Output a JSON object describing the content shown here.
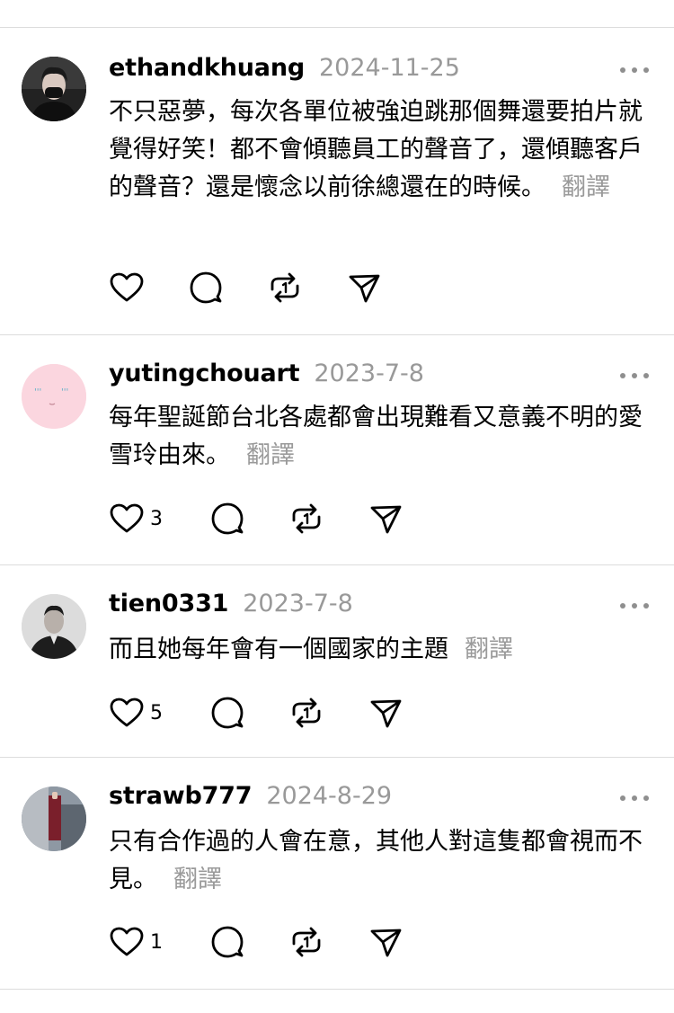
{
  "posts": [
    {
      "username": "ethandkhuang",
      "date": "2024-11-25",
      "text": "不只惡夢，每次各單位被強迫跳那個舞還要拍片就覺得好笑！都不會傾聽員工的聲音了，還傾聽客戶的聲音？還是懷念以前徐總還在的時候。",
      "translate": "翻譯",
      "likes": ""
    },
    {
      "username": "yutingchouart",
      "date": "2023-7-8",
      "text": "每年聖誕節台北各處都會出現難看又意義不明的愛雪玲由來。",
      "translate": "翻譯",
      "likes": "3"
    },
    {
      "username": "tien0331",
      "date": "2023-7-8",
      "text": "而且她每年會有一個國家的主題",
      "translate": "翻譯",
      "likes": "5"
    },
    {
      "username": "strawb777",
      "date": "2024-8-29",
      "text": "只有合作過的人會在意，其他人對這隻都會視而不見。",
      "translate": "翻譯",
      "likes": "1"
    }
  ],
  "icons": {
    "like": "heart-icon",
    "reply": "comment-icon",
    "repost": "repost-icon",
    "share": "send-icon",
    "more": "more-icon"
  }
}
